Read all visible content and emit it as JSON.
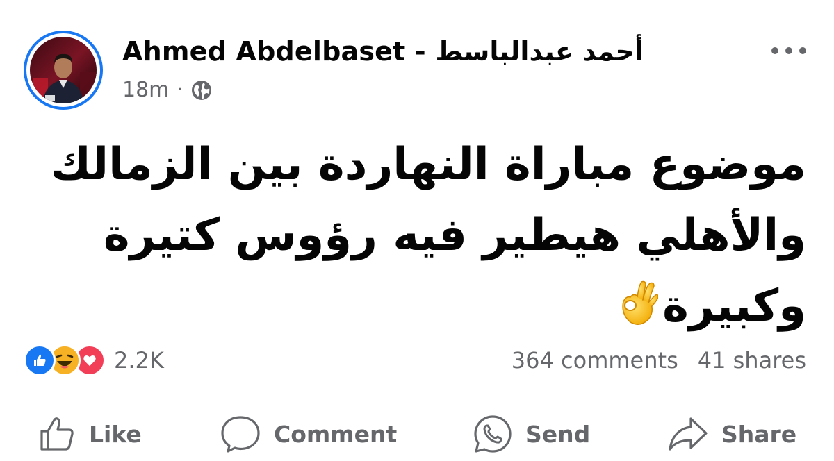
{
  "post": {
    "author_name": "Ahmed Abdelbaset - أحمد عبدالباسط",
    "time": "18m",
    "separator": "·",
    "privacy_icon": "globe-icon",
    "text_lines": [
      "موضوع مباراة النهاردة بين الزمالك",
      "والأهلي هيطير فيه رؤوس كتيرة",
      "وكبيرة"
    ],
    "emoji": "ok-hand"
  },
  "reactions": {
    "icons": [
      "like-reaction-icon",
      "haha-reaction-icon",
      "love-reaction-icon"
    ],
    "count": "2.2K"
  },
  "stats": {
    "comments": "364 comments",
    "shares": "41 shares"
  },
  "actions": {
    "like": "Like",
    "comment": "Comment",
    "send": "Send",
    "share": "Share"
  },
  "colors": {
    "accent": "#1877f2",
    "secondary_text": "#65676b",
    "primary_text": "#050505",
    "love": "#f33e58",
    "haha": "#f7b125"
  }
}
